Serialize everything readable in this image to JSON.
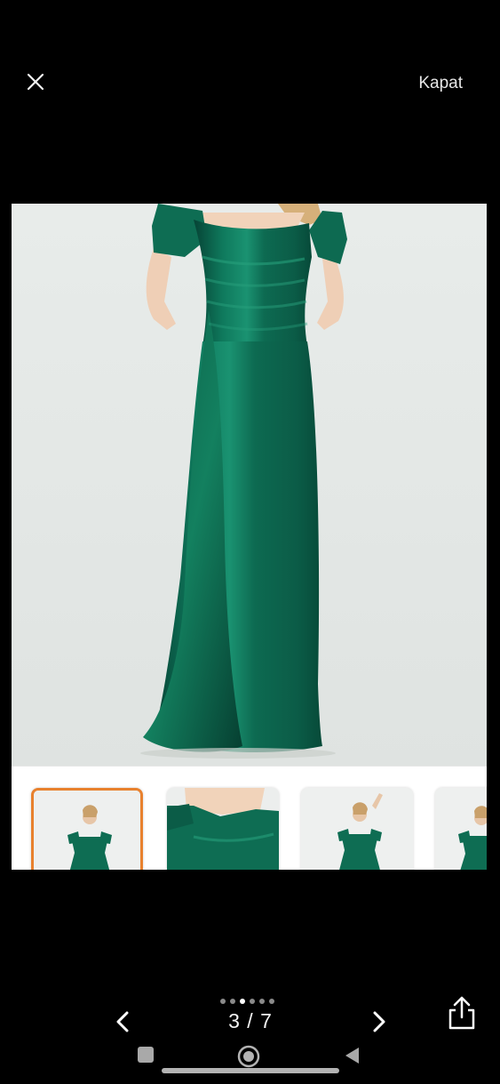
{
  "header": {
    "close_icon": "close-icon",
    "close_label": "Kapat"
  },
  "gallery": {
    "main_image": "green-satin-off-shoulder-evening-dress-photo",
    "thumbnails": [
      {
        "image": "full-length-dress-photo",
        "selected": true
      },
      {
        "image": "neckline-detail-photo",
        "selected": false
      },
      {
        "image": "full-length-dress-pose-photo",
        "selected": false
      },
      {
        "image": "dress-side-photo",
        "selected": false
      }
    ]
  },
  "pager": {
    "counter": "3 / 7",
    "dots_total": 6,
    "active_dot": 3,
    "prev_icon": "chevron-left-icon",
    "next_icon": "chevron-right-icon",
    "share_icon": "share-icon"
  },
  "system_nav": {
    "recents_icon": "recents-icon",
    "home_icon": "home-icon",
    "back_icon": "back-icon"
  },
  "colors": {
    "background": "#000000",
    "dress": "#0e6b52",
    "dress_shadow": "#064335",
    "photo_bg": "#e3e7e4",
    "thumb_selected_border": "#e8812e"
  }
}
